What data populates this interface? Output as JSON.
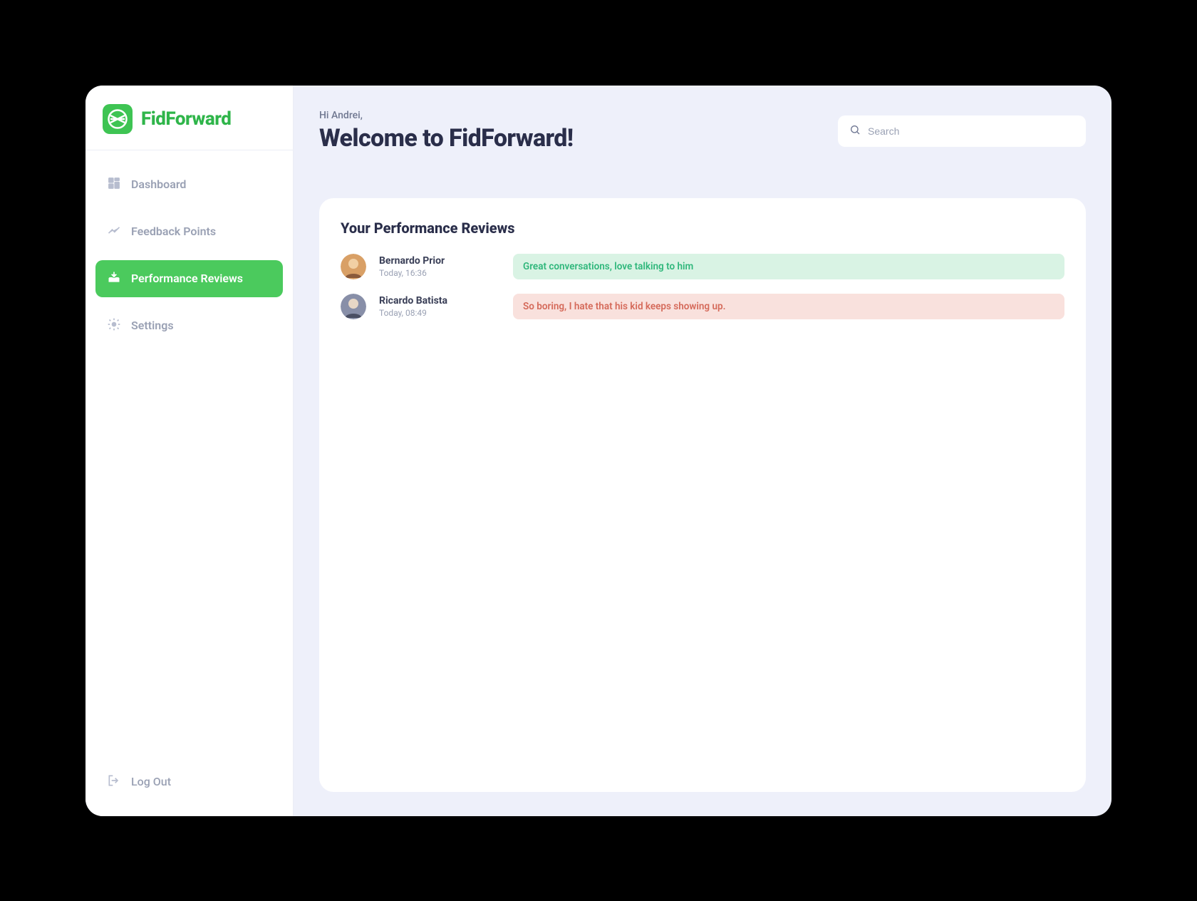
{
  "brand": {
    "name": "FidForward"
  },
  "sidebar": {
    "items": [
      {
        "label": "Dashboard"
      },
      {
        "label": "Feedback Points"
      },
      {
        "label": "Performance Reviews"
      },
      {
        "label": "Settings"
      }
    ],
    "logout_label": "Log Out"
  },
  "header": {
    "greeting": "Hi Andrei,",
    "title": "Welcome to FidForward!"
  },
  "search": {
    "placeholder": "Search"
  },
  "panel": {
    "title": "Your Performance Reviews",
    "reviews": [
      {
        "name": "Bernardo Prior",
        "time": "Today, 16:36",
        "text": "Great conversations, love talking to him",
        "sentiment": "positive"
      },
      {
        "name": "Ricardo Batista",
        "time": "Today, 08:49",
        "text": "So boring, I hate that his kid keeps showing up.",
        "sentiment": "negative"
      }
    ]
  }
}
